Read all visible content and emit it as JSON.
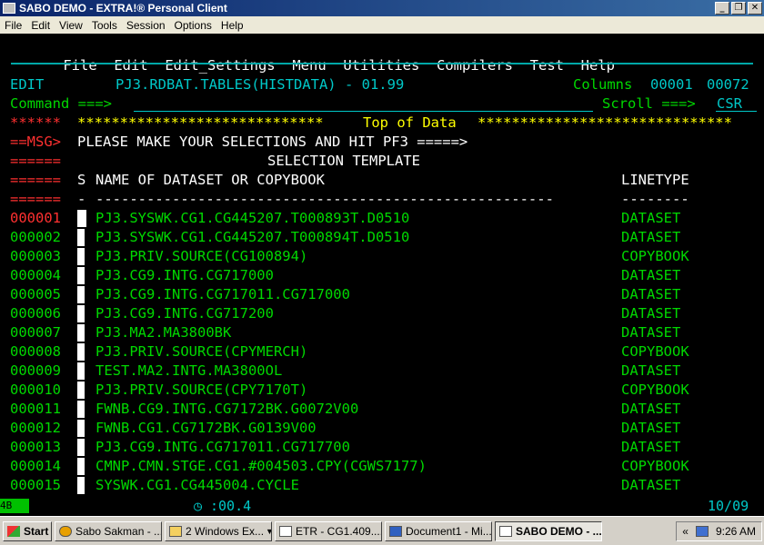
{
  "window": {
    "title": "SABO DEMO - EXTRA!® Personal Client",
    "menu": [
      "File",
      "Edit",
      "View",
      "Tools",
      "Session",
      "Options",
      "Help"
    ]
  },
  "ispf_menu": [
    "File",
    "Edit",
    "Edit_Settings",
    "Menu",
    "Utilities",
    "Compilers",
    "Test",
    "Help"
  ],
  "header": {
    "mode": "EDIT",
    "dataset": "PJ3.RDBAT.TABLES(HISTDATA) - 01.99",
    "columns_label": "Columns",
    "col_start": "00001",
    "col_end": "00072",
    "command_label": "Command ===>",
    "command_value": "",
    "scroll_label": "Scroll ===>",
    "scroll_value": "CSR"
  },
  "lines": {
    "top_prefix": "******",
    "top_stars_left": "*****************************",
    "top_text": "Top of Data",
    "top_stars_right": "******************************",
    "msg_prefix": "==MSG>",
    "msg_text": "PLEASE MAKE YOUR SELECTIONS AND HIT PF3 =====>",
    "sep_prefix": "======",
    "template_title": "SELECTION TEMPLATE",
    "col_s": "S",
    "col_name": "NAME OF DATASET OR COPYBOOK",
    "col_type": "LINETYPE",
    "dash_s": "-",
    "dash_name": "------------------------------------------------------",
    "dash_type": "--------"
  },
  "rows": [
    {
      "num": "000001",
      "name": "PJ3.SYSWK.CG1.CG445207.T000893T.D0510",
      "type": "DATASET"
    },
    {
      "num": "000002",
      "name": "PJ3.SYSWK.CG1.CG445207.T000894T.D0510",
      "type": "DATASET"
    },
    {
      "num": "000003",
      "name": "PJ3.PRIV.SOURCE(CG100894)",
      "type": "COPYBOOK"
    },
    {
      "num": "000004",
      "name": "PJ3.CG9.INTG.CG717000",
      "type": "DATASET"
    },
    {
      "num": "000005",
      "name": "PJ3.CG9.INTG.CG717011.CG717000",
      "type": "DATASET"
    },
    {
      "num": "000006",
      "name": "PJ3.CG9.INTG.CG717200",
      "type": "DATASET"
    },
    {
      "num": "000007",
      "name": "PJ3.MA2.MA3800BK",
      "type": "DATASET"
    },
    {
      "num": "000008",
      "name": "PJ3.PRIV.SOURCE(CPYMERCH)",
      "type": "COPYBOOK"
    },
    {
      "num": "000009",
      "name": "TEST.MA2.INTG.MA3800OL",
      "type": "DATASET"
    },
    {
      "num": "000010",
      "name": "PJ3.PRIV.SOURCE(CPY7170T)",
      "type": "COPYBOOK"
    },
    {
      "num": "000011",
      "name": "FWNB.CG9.INTG.CG7172BK.G0072V00",
      "type": "DATASET"
    },
    {
      "num": "000012",
      "name": "FWNB.CG1.CG7172BK.G0139V00",
      "type": "DATASET"
    },
    {
      "num": "000013",
      "name": "PJ3.CG9.INTG.CG717011.CG717700",
      "type": "DATASET"
    },
    {
      "num": "000014",
      "name": "CMNP.CMN.STGE.CG1.#004503.CPY(CGWS7177)",
      "type": "COPYBOOK"
    },
    {
      "num": "000015",
      "name": "SYSWK.CG1.CG445004.CYCLE",
      "type": "DATASET"
    }
  ],
  "status": {
    "session": "4B",
    "timer": ":00.4",
    "cursor_pos": "10/09"
  },
  "taskbar": {
    "start": "Start",
    "items": [
      "Sabo Sakman - ...",
      "2 Windows Ex...",
      "ETR - CG1.409....",
      "Document1 - Mi...",
      "SABO DEMO - ..."
    ],
    "active_index": 4,
    "tray_chevron": "«",
    "clock": "9:26 AM"
  },
  "colors": {
    "green": "#00d800",
    "cyan": "#00c8c8",
    "red": "#ff3030",
    "yellow": "#ffff00"
  }
}
